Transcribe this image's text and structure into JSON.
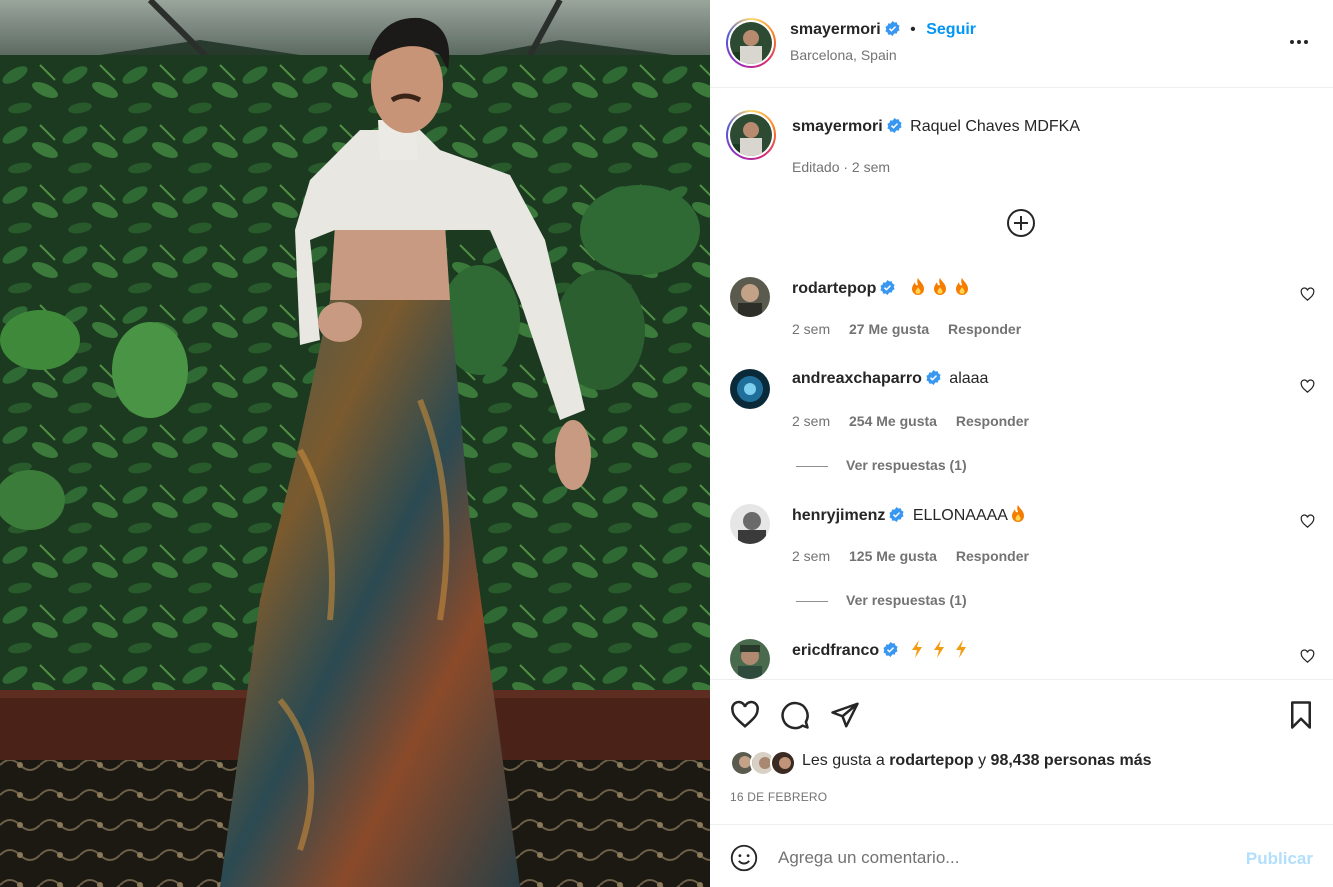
{
  "post": {
    "username": "smayermori",
    "follow_label": "Seguir",
    "separator": "•",
    "location": "Barcelona, Spain",
    "more_icon": "ellipsis-icon"
  },
  "caption": {
    "username": "smayermori",
    "text": "Raquel Chaves MDFKA",
    "meta": "Editado · 2 sem"
  },
  "comments": [
    {
      "username": "rodartepop",
      "text": "",
      "emoji": [
        "fire",
        "fire",
        "fire"
      ],
      "time": "2 sem",
      "likes": "27 Me gusta",
      "reply": "Responder",
      "replies": ""
    },
    {
      "username": "andreaxchaparro",
      "text": "alaaa",
      "emoji": [],
      "time": "2 sem",
      "likes": "254 Me gusta",
      "reply": "Responder",
      "replies": "Ver respuestas (1)"
    },
    {
      "username": "henryjimenz",
      "text": "ELLONAAAA",
      "emoji": [
        "fire"
      ],
      "time": "2 sem",
      "likes": "125 Me gusta",
      "reply": "Responder",
      "replies": "Ver respuestas (1)"
    },
    {
      "username": "ericdfranco",
      "text": "",
      "emoji": [
        "bolt",
        "bolt",
        "bolt"
      ],
      "time": "",
      "likes": "",
      "reply": "",
      "replies": ""
    }
  ],
  "actions": {
    "likes_prefix": "Les gusta a",
    "likes_user": "rodartepop",
    "likes_joiner": "y",
    "likes_rest": "98,438 personas más",
    "date": "16 DE FEBRERO"
  },
  "composer": {
    "placeholder": "Agrega un comentario...",
    "publish_label": "Publicar"
  },
  "colors": {
    "accent": "#0095f6",
    "verified": "#3897f0",
    "publish_disabled": "#b2dffc",
    "muted_text": "#737373"
  }
}
